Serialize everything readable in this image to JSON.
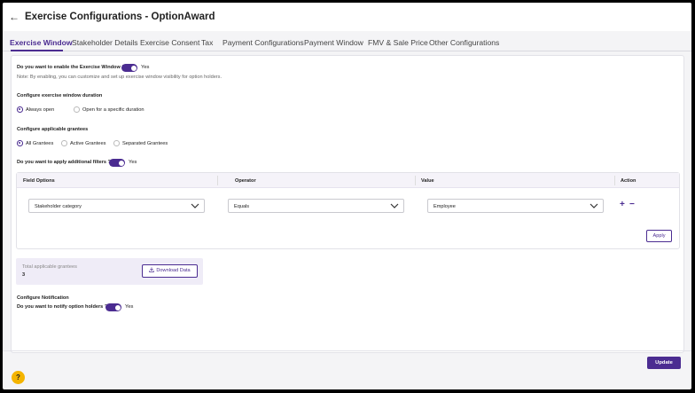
{
  "header": {
    "back_icon": "arrow-left-icon",
    "title": "Exercise Configurations - OptionAward"
  },
  "tabs": [
    {
      "label": "Exercise Window",
      "active": true
    },
    {
      "label": "Stakeholder Details"
    },
    {
      "label": "Exercise Consent"
    },
    {
      "label": "Tax"
    },
    {
      "label": "Payment Configurations"
    },
    {
      "label": "Payment Window"
    },
    {
      "label": "FMV & Sale Price"
    },
    {
      "label": "Other Configurations"
    }
  ],
  "window": {
    "question": "Do you want to enable the Exercise Window ?",
    "toggle_label": "Yes",
    "note": "Note: By enabling, you can customize and set up exercise window visibility for option holders."
  },
  "duration": {
    "title": "Configure exercise window duration",
    "options": [
      "Always open",
      "Open for a specific duration"
    ],
    "selected": "Always open"
  },
  "grantees": {
    "title": "Configure applicable grantees",
    "options": [
      "All Grantees",
      "Active Grantees",
      "Separated Grantees"
    ],
    "selected": "All Grantees"
  },
  "filters": {
    "question": "Do you want to apply additional filters ?",
    "toggle_label": "Yes",
    "columns": [
      "Field Options",
      "Operator",
      "Value",
      "Action"
    ],
    "row": {
      "field": "Stakeholder category",
      "operator": "Equals",
      "value": "Employee",
      "add": "+",
      "remove": "−"
    },
    "apply_label": "Apply"
  },
  "summary": {
    "label": "Total applicable grantees",
    "count": "3",
    "download_label": "Download Data"
  },
  "notification": {
    "title": "Configure Notification",
    "question": "Do you want to notify option holders ?",
    "toggle_label": "Yes"
  },
  "update_label": "Update",
  "help_icon": "?",
  "colors": {
    "accent": "#4b2c91",
    "help": "#f4b400"
  }
}
